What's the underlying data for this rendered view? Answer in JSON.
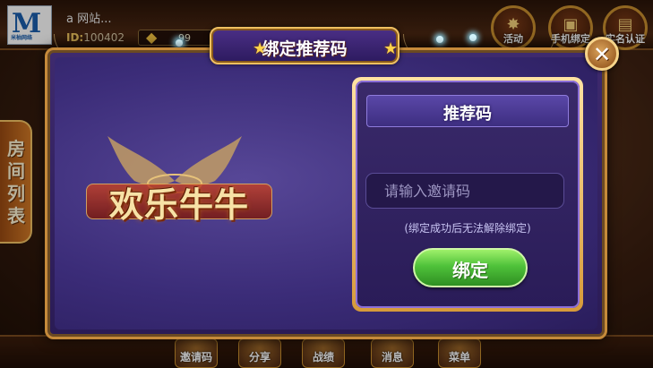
{
  "lobby": {
    "logo_letter": "M",
    "logo_caption": "米柚网络",
    "user_name": "a 网站...",
    "user_id_label": "ID:",
    "user_id": "100402",
    "gem_count": "99",
    "gem_plus": "+",
    "top_buttons": [
      {
        "label": "活动",
        "icon": "activity-icon"
      },
      {
        "label": "手机绑定",
        "icon": "phone-bind-icon"
      },
      {
        "label": "实名认证",
        "icon": "realname-icon"
      }
    ],
    "room_list_tab": "房间列表",
    "bottom_nav": [
      {
        "label": "邀请码"
      },
      {
        "label": "分享"
      },
      {
        "label": "战绩"
      },
      {
        "label": "消息"
      },
      {
        "label": "菜单"
      }
    ]
  },
  "modal": {
    "title": "绑定推荐码",
    "close_symbol": "✕",
    "game_logo": "欢乐牛牛",
    "panel_header": "推荐码",
    "input_placeholder": "请输入邀请码",
    "input_value": "",
    "hint": "(绑定成功后无法解除绑定)",
    "bind_button": "绑定"
  },
  "colors": {
    "modal_bg": "#3b2c78",
    "gold_border": "#c58a3a",
    "bind_green": "#4fc23a"
  }
}
